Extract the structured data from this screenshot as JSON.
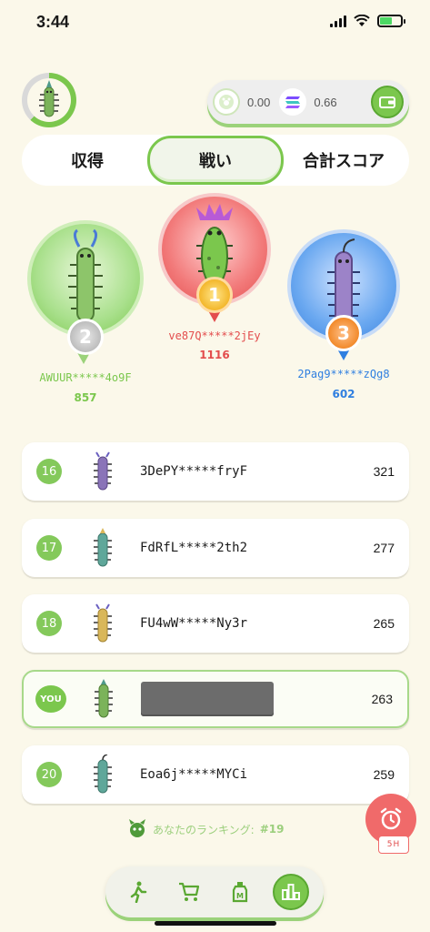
{
  "status_bar": {
    "time": "3:44"
  },
  "wallet": {
    "coin1_value": "0.00",
    "coin2_value": "0.66"
  },
  "tabs": [
    {
      "label": "収得"
    },
    {
      "label": "戦い",
      "active": true
    },
    {
      "label": "合計スコア"
    }
  ],
  "podium": {
    "first": {
      "rank": "1",
      "name": "ve87Q*****2jEy",
      "score": "1116",
      "color": "#e34d4d"
    },
    "second": {
      "rank": "2",
      "name": "AWUUR*****4o9F",
      "score": "857",
      "color": "#7bc74d"
    },
    "third": {
      "rank": "3",
      "name": "2Pag9*****zQg8",
      "score": "602",
      "color": "#2f7fe0"
    }
  },
  "list": [
    {
      "rank": "16",
      "name": "3DePY*****fryF",
      "score": "321",
      "bug_color": "#8a74b8"
    },
    {
      "rank": "17",
      "name": "FdRfL*****2th2",
      "score": "277",
      "bug_color": "#5fa79a"
    },
    {
      "rank": "18",
      "name": "FU4wW*****Ny3r",
      "score": "265",
      "bug_color": "#d9b75a"
    },
    {
      "rank": "YOU",
      "name": "",
      "score": "263",
      "bug_color": "#7bb35a",
      "me": true
    },
    {
      "rank": "20",
      "name": "Eoa6j*****MYCi",
      "score": "259",
      "bug_color": "#5fa79a"
    }
  ],
  "my_ranking": {
    "label": "あなたのランキング:",
    "value": "#19"
  },
  "alarm": {
    "tag": "5H"
  }
}
